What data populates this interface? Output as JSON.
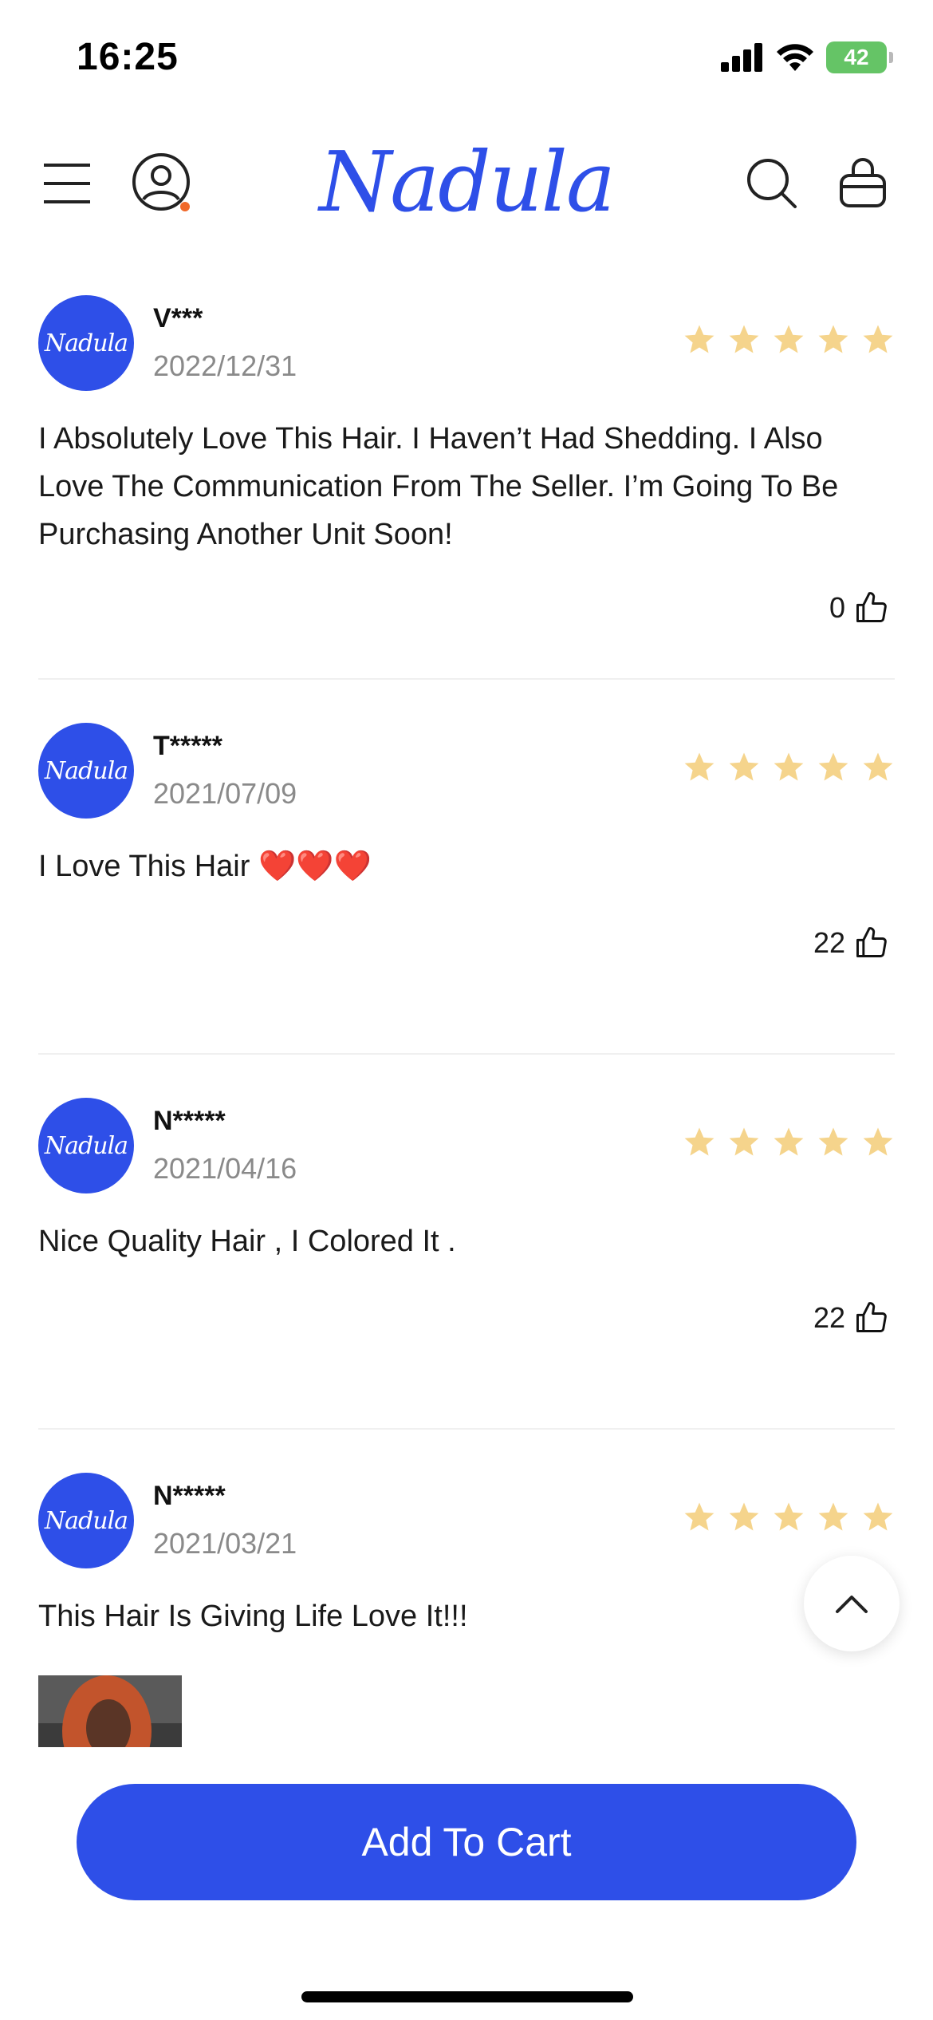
{
  "status_bar": {
    "time": "16:25",
    "battery": "42"
  },
  "header": {
    "logo": "Nadula"
  },
  "reviews": [
    {
      "avatar_text": "Nadula",
      "name": "V***",
      "date": "2022/12/31",
      "rating": 5,
      "text": "I Absolutely Love This Hair. I Haven’t Had Shedding. I Also Love The Communication From The Seller. I’m Going To Be Purchasing Another Unit Soon!",
      "likes": "0"
    },
    {
      "avatar_text": "Nadula",
      "name": "T*****",
      "date": "2021/07/09",
      "rating": 5,
      "text": "I Love This Hair ❤️❤️❤️",
      "likes": "22"
    },
    {
      "avatar_text": "Nadula",
      "name": "N*****",
      "date": "2021/04/16",
      "rating": 5,
      "text": "Nice Quality Hair , I Colored It .",
      "likes": "22"
    },
    {
      "avatar_text": "Nadula",
      "name": "N*****",
      "date": "2021/03/21",
      "rating": 5,
      "text": "This Hair Is Giving Life Love It!!!",
      "likes": ""
    }
  ],
  "cta": {
    "add_to_cart": "Add To Cart"
  },
  "colors": {
    "brand": "#2e4fe8",
    "star": "#f5d48c",
    "notification_dot": "#f0692a"
  }
}
